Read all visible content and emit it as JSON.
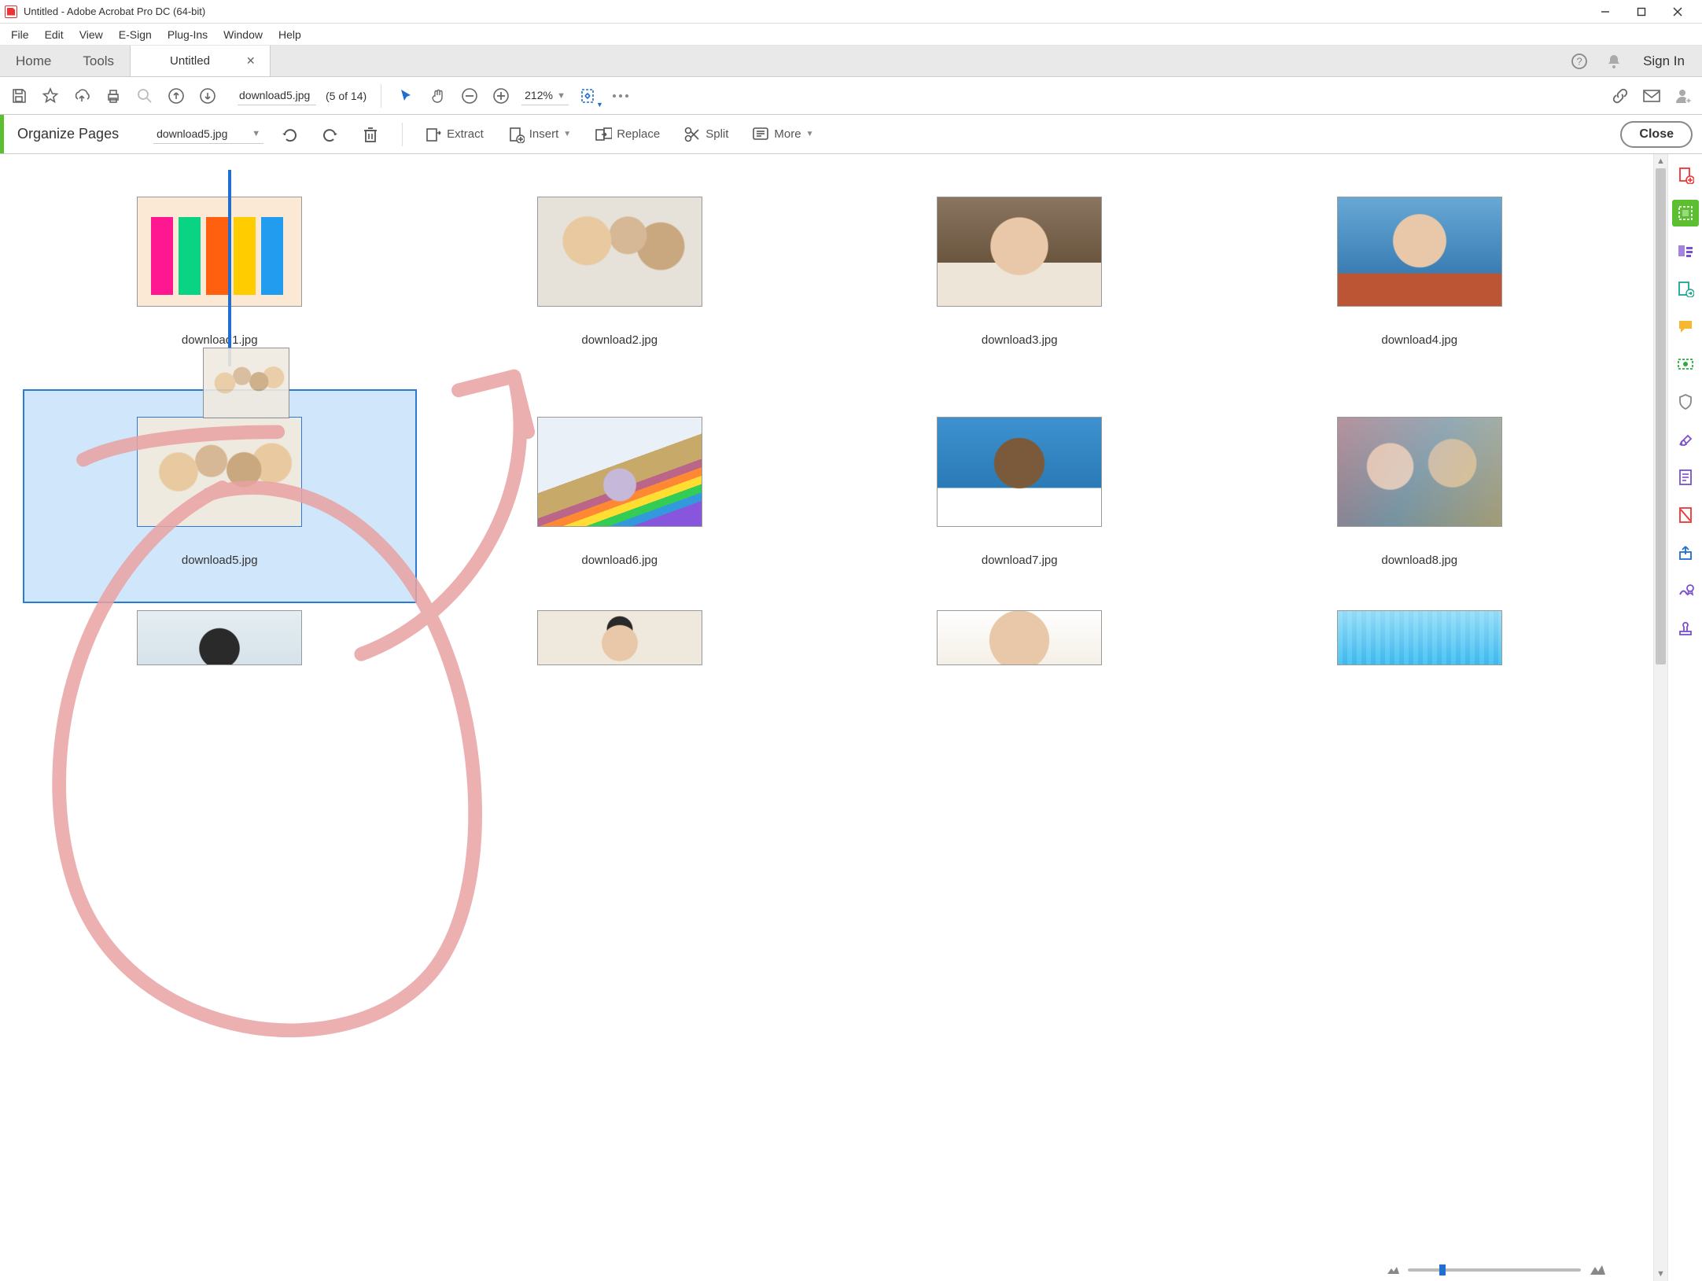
{
  "window": {
    "title": "Untitled - Adobe Acrobat Pro DC (64-bit)"
  },
  "menu": [
    "File",
    "Edit",
    "View",
    "E-Sign",
    "Plug-Ins",
    "Window",
    "Help"
  ],
  "main_tabs": {
    "home": "Home",
    "tools": "Tools",
    "doc_tab": "Untitled"
  },
  "header_right": {
    "sign_in": "Sign In"
  },
  "toolbar": {
    "current_file": "download5.jpg",
    "page_indicator": "(5 of 14)",
    "zoom": "212%"
  },
  "organize": {
    "title": "Organize Pages",
    "file_selector": "download5.jpg",
    "extract": "Extract",
    "insert": "Insert",
    "replace": "Replace",
    "split": "Split",
    "more": "More",
    "close": "Close"
  },
  "pages": [
    {
      "label": "download1.jpg",
      "kind": "illus",
      "selected": false
    },
    {
      "label": "download2.jpg",
      "kind": "group1",
      "selected": false
    },
    {
      "label": "download3.jpg",
      "kind": "portrait1",
      "selected": false
    },
    {
      "label": "download4.jpg",
      "kind": "portrait2",
      "selected": false
    },
    {
      "label": "download5.jpg",
      "kind": "group2",
      "selected": true
    },
    {
      "label": "download6.jpg",
      "kind": "flag",
      "selected": false
    },
    {
      "label": "download7.jpg",
      "kind": "portrait3",
      "selected": false
    },
    {
      "label": "download8.jpg",
      "kind": "pair",
      "selected": false
    },
    {
      "label": "",
      "kind": "dog",
      "selected": false
    },
    {
      "label": "",
      "kind": "hat",
      "selected": false
    },
    {
      "label": "",
      "kind": "face",
      "selected": false
    },
    {
      "label": "",
      "kind": "crowd",
      "selected": false
    }
  ],
  "drag": {
    "ghost_kind": "group2",
    "insert_after_index": 0
  }
}
